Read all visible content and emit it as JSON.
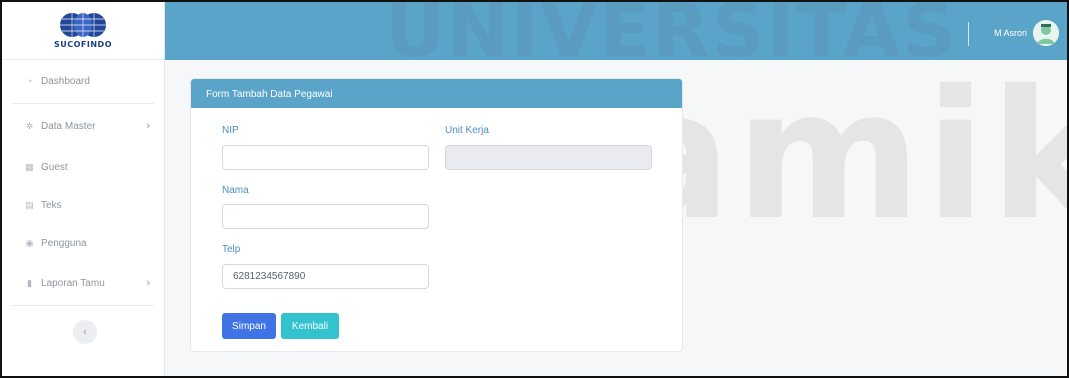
{
  "app": {
    "logo_text": "SUCOFINDO",
    "watermark_top": "UNIVERSITAS",
    "watermark_main": "Dinamika"
  },
  "sidebar": {
    "items": [
      {
        "label": "Dashboard",
        "icon": "dashboard-icon",
        "has_submenu": false
      },
      {
        "label": "Data Master",
        "icon": "gear-icon",
        "has_submenu": true
      },
      {
        "label": "Guest",
        "icon": "grid-icon",
        "has_submenu": false
      },
      {
        "label": "Teks",
        "icon": "list-icon",
        "has_submenu": false
      },
      {
        "label": "Pengguna",
        "icon": "user-circle-icon",
        "has_submenu": false
      },
      {
        "label": "Laporan Tamu",
        "icon": "file-icon",
        "has_submenu": true
      }
    ],
    "collapse_icon": "chevron-left-icon"
  },
  "topbar": {
    "user_name": "M Asrori",
    "avatar_icon": "avatar-icon",
    "color": "#5aa3c9"
  },
  "form": {
    "title": "Form Tambah Data Pegawai",
    "fields": {
      "nip": {
        "label": "NIP",
        "value": ""
      },
      "unit_kerja": {
        "label": "Unit Kerja",
        "value": "",
        "disabled": true
      },
      "nama": {
        "label": "Nama",
        "value": ""
      },
      "telp": {
        "label": "Telp",
        "value": "6281234567890"
      }
    },
    "buttons": {
      "save": "Simpan",
      "back": "Kembali"
    }
  },
  "colors": {
    "accent": "#5aa3c9",
    "primary_button": "#3f73e6",
    "info_button": "#33c3cf",
    "label": "#4b8ec0"
  }
}
